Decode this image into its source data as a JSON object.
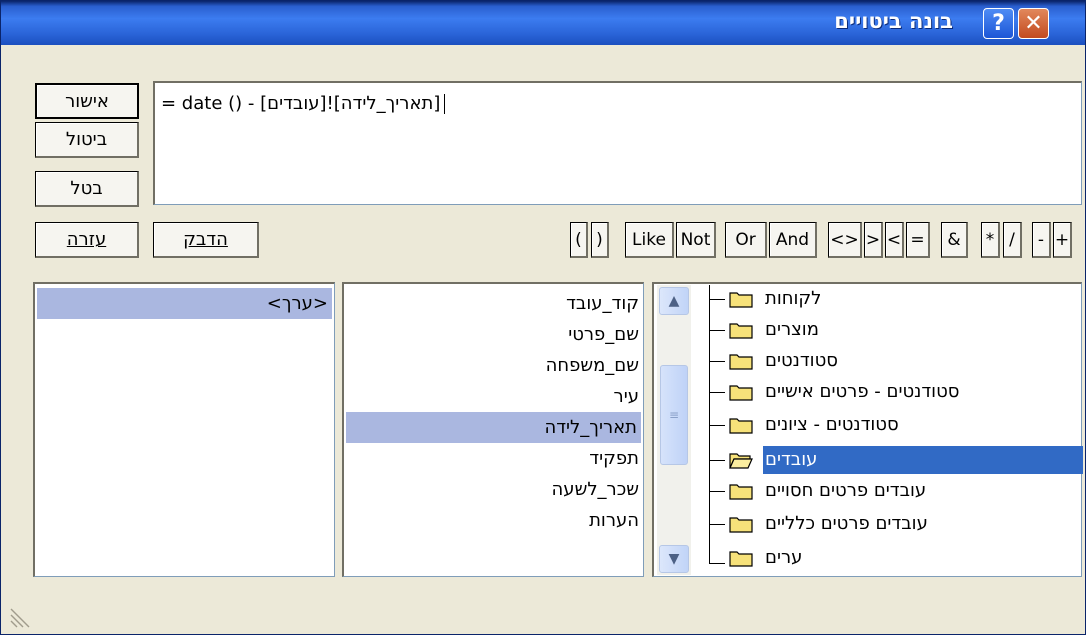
{
  "window": {
    "title": "בונה ביטויים",
    "close_glyph": "✕",
    "help_glyph": "?"
  },
  "expression": {
    "text": "= date () - [עובדים]![תאריך_לידה]"
  },
  "buttons": {
    "ok": "אישור",
    "cancel": "ביטול",
    "undo": "בטל",
    "help": "עזרה",
    "paste": "הדבק"
  },
  "operators": [
    "(",
    ")",
    "Like",
    "Not",
    "Or",
    "And",
    "<>",
    ">",
    "<",
    "=",
    "&",
    "*",
    "/",
    "-",
    "+"
  ],
  "values_list": {
    "items": [
      "<ערך>"
    ],
    "selected": 0
  },
  "fields_list": {
    "items": [
      "קוד_עובד",
      "שם_פרטי",
      "שם_משפחה",
      "עיר",
      "תאריך_לידה",
      "תפקיד",
      "שכר_לשעה",
      "הערות"
    ],
    "selected": 4
  },
  "tree": {
    "items": [
      "לקוחות",
      "מוצרים",
      "סטודנטים",
      "סטודנטים - פרטים אישיים",
      "סטודנטים - ציונים",
      "עובדים",
      "עובדים פרטים חסויים",
      "עובדים פרטים כלליים",
      "ערים"
    ],
    "selected": 5
  },
  "colors": {
    "titlebar": "#2a64d8",
    "selection": "#316ac5",
    "selection_inactive": "#aab7e0"
  }
}
